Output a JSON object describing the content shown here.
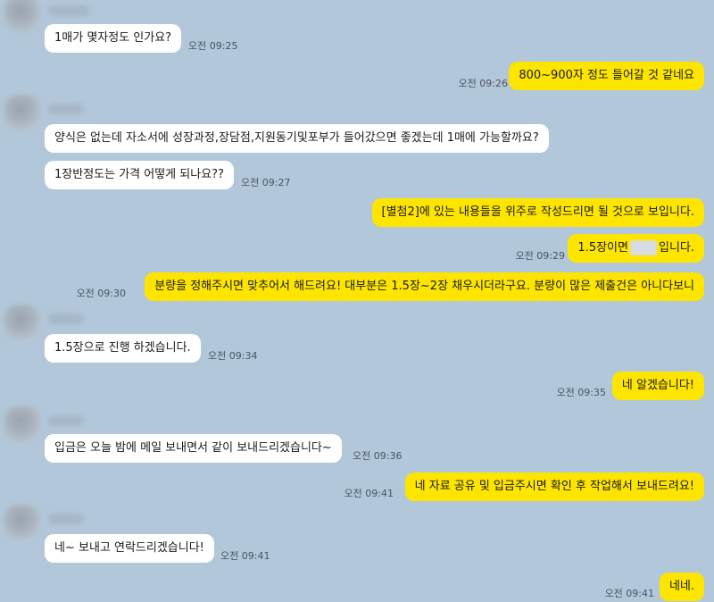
{
  "messages": [
    {
      "text": "1매가 몇자정도 인가요?",
      "time": "오전 09:25"
    },
    {
      "text": "800~900자 정도 들어갈 것 같네요",
      "time": "오전 09:26"
    },
    {
      "text": "양식은 없는데 자소서에 성장과정,장담점,지원동기및포부가 들어갔으면 좋겠는데 1매에 가능할까요?"
    },
    {
      "text": "1장반정도는 가격 어떻게 되나요??",
      "time": "오전 09:27"
    },
    {
      "text": "[별첨2]에 있는 내용들을 위주로 작성드리면 될 것으로 보입니다."
    },
    {
      "text_before": "1.5장이면",
      "text_after": "입니다.",
      "time": "오전 09:29"
    },
    {
      "text": "분량을 정해주시면 맞추어서 해드려요! 대부분은 1.5장~2장 채우시더라구요. 분량이 많은 제출건은 아니다보니",
      "time": "오전 09:30"
    },
    {
      "text": "1.5장으로 진행 하겠습니다.",
      "time": "오전 09:34"
    },
    {
      "text": "네 알겠습니다!",
      "time": "오전 09:35"
    },
    {
      "text": "입금은 오늘 밤에 메일 보내면서 같이 보내드리겠습니다~",
      "time": "오전 09:36"
    },
    {
      "text": "네 자료 공유 및 입금주시면 확인 후 작업해서 보내드려요!",
      "time": "오전 09:41"
    },
    {
      "text": "네~ 보내고 연락드리겠습니다!",
      "time": "오전 09:41"
    },
    {
      "text": "네네.",
      "time": "오전 09:41"
    }
  ]
}
